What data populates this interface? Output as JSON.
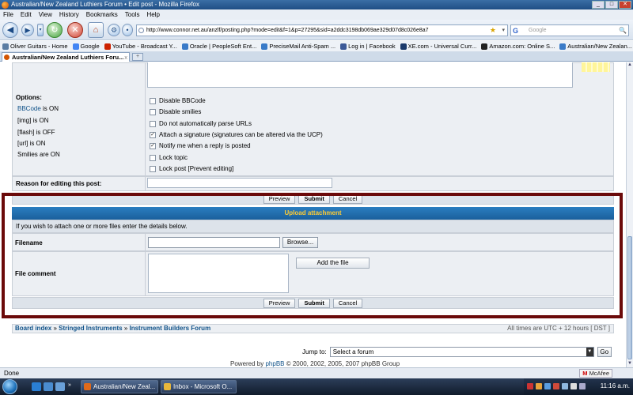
{
  "window": {
    "title": "Australian/New Zealand Luthiers Forum • Edit post - Mozilla Firefox",
    "controls": [
      "_",
      "□",
      "✕"
    ]
  },
  "menu": [
    "File",
    "Edit",
    "View",
    "History",
    "Bookmarks",
    "Tools",
    "Help"
  ],
  "nav": {
    "url": "http://www.connor.net.au/anzlf/posting.php?mode=edit&f=1&p=27295&sid=a2ddc3198db069ae329d07d8c026e8a7",
    "search_placeholder": "Google"
  },
  "bookmarks": [
    "Oliver Guitars - Home",
    "Google",
    "YouTube - Broadcast Y...",
    "Oracle | PeopleSoft Ent...",
    "PreciseMail Anti-Spam ...",
    "Log in | Facebook",
    "XE.com - Universal Curr...",
    "Amazon.com: Online S...",
    "Australian/New Zealan..."
  ],
  "tab": {
    "label": "Australian/New Zealand Luthiers Foru...",
    "close": "x",
    "new": "+"
  },
  "options": {
    "title": "Options:",
    "bbcode_link": "BBCode",
    "bbcode_state": " is ON",
    "img": "[img] is ON",
    "flash": "[flash] is OFF",
    "url": "[url] is ON",
    "smilies": "Smilies are ON",
    "checkboxes": [
      {
        "label": "Disable BBCode",
        "mark": ""
      },
      {
        "label": "Disable smilies",
        "mark": ""
      },
      {
        "label": "Do not automatically parse URLs",
        "mark": ""
      },
      {
        "label": "Attach a signature (signatures can be altered via the UCP)",
        "mark": "✓"
      },
      {
        "label": "Notify me when a reply is posted",
        "mark": "✓"
      },
      {
        "label": "Lock topic",
        "mark": ""
      },
      {
        "label": "Lock post [Prevent editing]",
        "mark": ""
      }
    ]
  },
  "reason": {
    "label": "Reason for editing this post:",
    "value": ""
  },
  "buttons": {
    "preview": "Preview",
    "submit": "Submit",
    "cancel": "Cancel"
  },
  "attachment": {
    "header": "Upload attachment",
    "description": "If you wish to attach one or more files enter the details below.",
    "filename_label": "Filename",
    "browse": "Browse...",
    "comment_label": "File comment",
    "add_file": "Add the file"
  },
  "breadcrumb": {
    "items": [
      "Board index",
      "Stringed Instruments",
      "Instrument Builders Forum"
    ],
    "separator": " » ",
    "timezone": "All times are UTC + 12 hours [ DST ]"
  },
  "jump": {
    "label": "Jump to:",
    "selected": "Select a forum",
    "go": "Go"
  },
  "footer": {
    "prefix": "Powered by ",
    "link": "phpBB",
    "suffix": " © 2000, 2002, 2005, 2007 phpBB Group"
  },
  "status": {
    "text": "Done",
    "mcafee": "McAfee"
  },
  "taskbar": {
    "tasks": [
      "Australian/New Zeal...",
      "Inbox - Microsoft O..."
    ],
    "clock": "11:16 a.m."
  }
}
